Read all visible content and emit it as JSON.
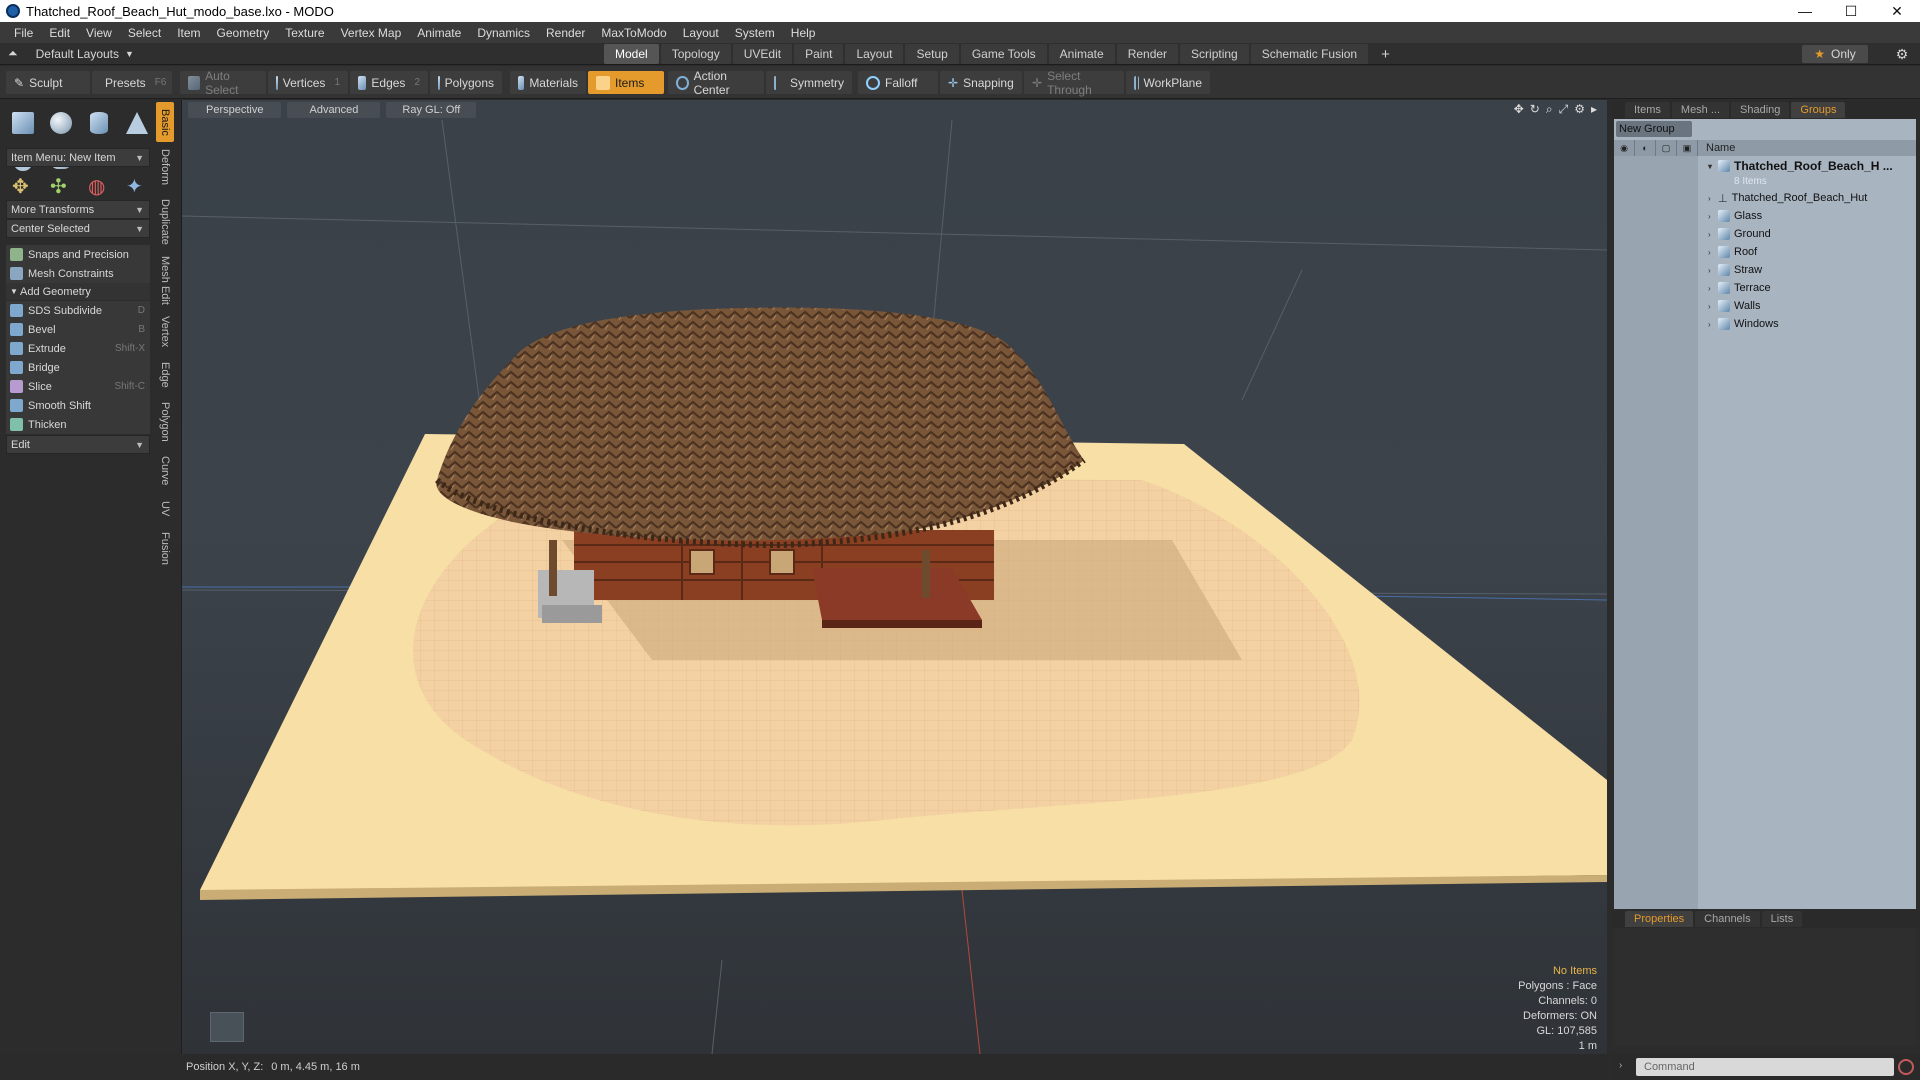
{
  "window": {
    "title": "Thatched_Roof_Beach_Hut_modo_base.lxo - MODO",
    "minimize": "—",
    "maximize": "☐",
    "close": "✕"
  },
  "menu": [
    "File",
    "Edit",
    "View",
    "Select",
    "Item",
    "Geometry",
    "Texture",
    "Vertex Map",
    "Animate",
    "Dynamics",
    "Render",
    "MaxToModo",
    "Layout",
    "System",
    "Help"
  ],
  "layoutbar": {
    "layout_selector": "Default Layouts",
    "tabs": [
      "Model",
      "Topology",
      "UVEdit",
      "Paint",
      "Layout",
      "Setup",
      "Game Tools",
      "Animate",
      "Render",
      "Scripting",
      "Schematic Fusion"
    ],
    "active_tab": "Model",
    "add": "+",
    "only": "Only"
  },
  "toolbar": {
    "sculpt": "Sculpt",
    "presets": "Presets",
    "presets_hotkey": "F6",
    "auto_select": "Auto Select",
    "vertices": "Vertices",
    "vertices_hotkey": "1",
    "edges": "Edges",
    "edges_hotkey": "2",
    "polygons": "Polygons",
    "materials": "Materials",
    "items": "Items",
    "action_center": "Action Center",
    "symmetry": "Symmetry",
    "falloff": "Falloff",
    "snapping": "Snapping",
    "select_through": "Select Through",
    "workplane": "WorkPlane"
  },
  "lefttools": {
    "side_tabs": [
      "Basic",
      "Deform",
      "Duplicate",
      "Mesh Edit",
      "Vertex",
      "Edge",
      "Polygon",
      "Curve",
      "UV",
      "Fusion"
    ],
    "item_menu": "Item Menu: New Item",
    "more_transforms": "More Transforms",
    "center_selected": "Center Selected",
    "snaps": "Snaps and Precision",
    "mesh_constraints": "Mesh Constraints",
    "add_geometry": "Add Geometry",
    "tools": [
      {
        "label": "SDS Subdivide",
        "hotkey": "D"
      },
      {
        "label": "Bevel",
        "hotkey": "B"
      },
      {
        "label": "Extrude",
        "hotkey": "Shift-X"
      },
      {
        "label": "Bridge",
        "hotkey": ""
      },
      {
        "label": "Slice",
        "hotkey": "Shift-C"
      },
      {
        "label": "Smooth Shift",
        "hotkey": ""
      },
      {
        "label": "Thicken",
        "hotkey": ""
      }
    ],
    "edit": "Edit"
  },
  "viewport": {
    "view": "Perspective",
    "shading": "Advanced",
    "raygl": "Ray GL: Off",
    "info": {
      "items": "No Items",
      "polygons": "Polygons : Face",
      "channels": "Channels: 0",
      "deformers": "Deformers: ON",
      "gl": "GL: 107,585",
      "scale": "1 m"
    }
  },
  "statusbar": {
    "label": "Position X, Y, Z:",
    "value": "0 m, 4.45 m, 16 m"
  },
  "rightpanel": {
    "tabs": [
      "Items",
      "Mesh ...",
      "Shading",
      "Groups"
    ],
    "active_tab": "Groups",
    "new_group": "New Group",
    "name_col": "Name",
    "group_name": "Thatched_Roof_Beach_H ...",
    "group_count": "8 Items",
    "items": [
      "Thatched_Roof_Beach_Hut",
      "Glass",
      "Ground",
      "Roof",
      "Straw",
      "Terrace",
      "Walls",
      "Windows"
    ],
    "lower_tabs": [
      "Properties",
      "Channels",
      "Lists"
    ],
    "lower_active": "Properties",
    "command_placeholder": "Command"
  },
  "colors": {
    "accent": "#e59a2c",
    "sand": "#f6dfa6",
    "thatch": "#6e4d34",
    "wood": "#8b3f22"
  }
}
